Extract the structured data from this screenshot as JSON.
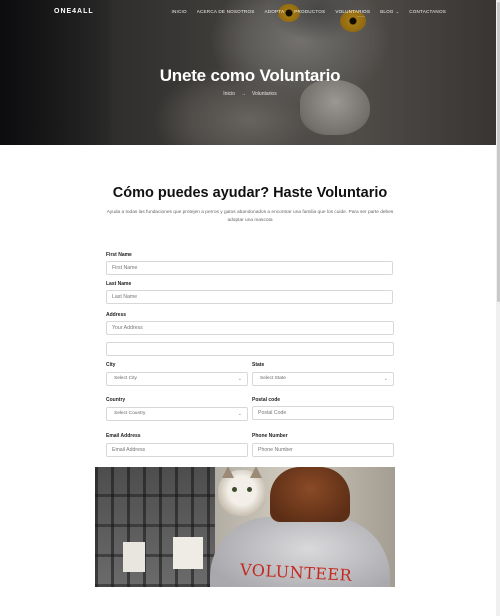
{
  "brand": {
    "logo": "ONE4ALL"
  },
  "nav": {
    "items": [
      "INICIO",
      "ACERCA DE NOSOTROS",
      "ADOPTA",
      "PRODUCTOS",
      "VOLUNTARIOS",
      "BLOG",
      "CONTACTANOS"
    ],
    "active": "VOLUNTARIOS",
    "blog_has_dropdown": true,
    "active_marker": "~~~~"
  },
  "hero": {
    "title": "Unete como Voluntario",
    "breadcrumb": {
      "home": "Inicio",
      "separator": "→",
      "current": "Voluntarios"
    }
  },
  "intro": {
    "title": "Cómo puedes ayudar? Haste Voluntario",
    "description": "Ayuda a todas las fundaciones que protejen a perros y gatos abandonados a encontrar una familia que los cuide. Para ser parte debes adoptar una mascota"
  },
  "form": {
    "first_name": {
      "label": "First Name",
      "placeholder": "First Name"
    },
    "last_name": {
      "label": "Last Name",
      "placeholder": "Last Name"
    },
    "address": {
      "label": "Address",
      "placeholder": "Your Address",
      "line2_placeholder": ""
    },
    "city": {
      "label": "City",
      "value": "Select City"
    },
    "state": {
      "label": "State",
      "value": "Select State"
    },
    "country": {
      "label": "Country",
      "value": "Select Country"
    },
    "postal": {
      "label": "Postal code",
      "placeholder": "Postal Code"
    },
    "email": {
      "label": "Email Address",
      "placeholder": "Email Address"
    },
    "phone": {
      "label": "Phone Number",
      "placeholder": "Phone Number"
    }
  },
  "photo": {
    "shirt_text": "VOLUNTEER"
  },
  "colors": {
    "accent_red": "#c4281f",
    "field_border": "#d8d8d8"
  }
}
